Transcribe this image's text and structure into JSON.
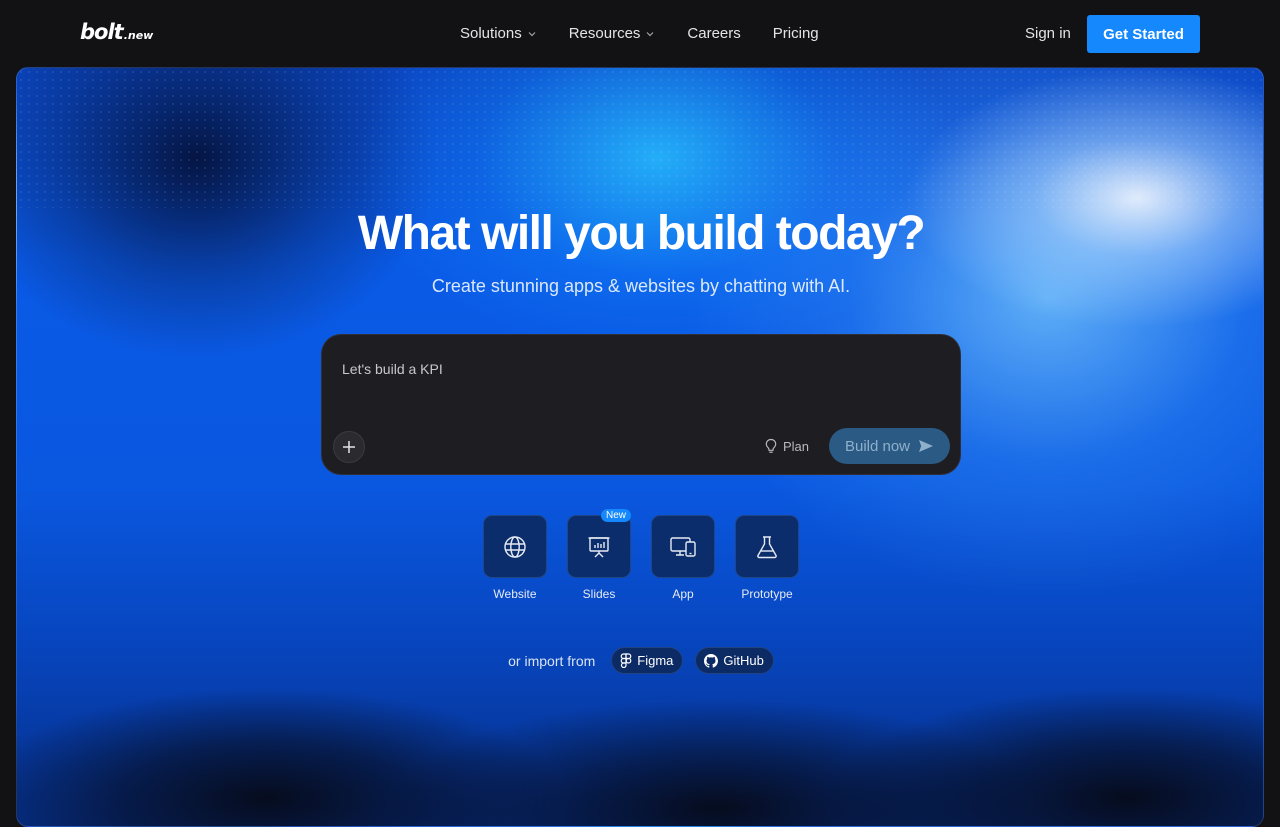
{
  "header": {
    "logo_main": "bolt",
    "logo_sub": ".new",
    "nav": [
      {
        "label": "Solutions",
        "has_dropdown": true
      },
      {
        "label": "Resources",
        "has_dropdown": true
      },
      {
        "label": "Careers",
        "has_dropdown": false
      },
      {
        "label": "Pricing",
        "has_dropdown": false
      }
    ],
    "signin_label": "Sign in",
    "cta_label": "Get Started"
  },
  "hero": {
    "title": "What will you build today?",
    "subtitle": "Create stunning apps & websites by chatting with AI."
  },
  "prompt": {
    "value": "Let's build a KPI",
    "plan_label": "Plan",
    "build_label": "Build now"
  },
  "types": [
    {
      "label": "Website",
      "icon": "globe-icon",
      "badge": ""
    },
    {
      "label": "Slides",
      "icon": "presentation-icon",
      "badge": "New"
    },
    {
      "label": "App",
      "icon": "devices-icon",
      "badge": ""
    },
    {
      "label": "Prototype",
      "icon": "flask-icon",
      "badge": ""
    }
  ],
  "import": {
    "label": "or import from",
    "sources": [
      {
        "label": "Figma",
        "icon": "figma-icon"
      },
      {
        "label": "GitHub",
        "icon": "github-icon"
      }
    ]
  },
  "colors": {
    "accent": "#1488fc",
    "background": "#121214",
    "prompt_bg": "#1e1e22",
    "tile_bg": "#0c2d6b"
  }
}
